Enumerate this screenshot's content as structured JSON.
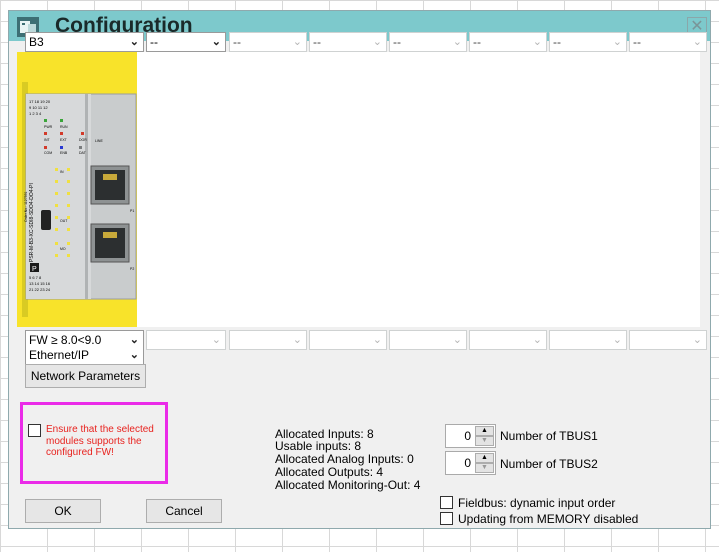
{
  "window": {
    "title": "Configuration",
    "close_glyph": "✕",
    "icon": "module-icon"
  },
  "module_combo": {
    "value": "B3",
    "arrow": "⌄"
  },
  "slot_combos": [
    "--",
    "--",
    "--",
    "--",
    "--",
    "--",
    "--"
  ],
  "fw_combo": {
    "value": "FW ≥ 8.0<9.0",
    "arrow": "⌄"
  },
  "protocol_combo": {
    "value": "Ethernet/IP",
    "arrow": "⌄"
  },
  "network_button": "Network Parameters",
  "module": {
    "label": "PSR-M-B3-XC-SDI8-SDO4-DO4-PI",
    "order_no": "Order.No.: 1127591",
    "top_terminals": [
      "17 18 19 20",
      "9 10 11 12",
      "1 2 3 4"
    ],
    "bottom_terminals": [
      "5 6 7 8",
      "13 14 15 16",
      "21 22 23 24"
    ],
    "leds": [
      "PWR",
      "RUN",
      "INT",
      "EXT",
      "DGR",
      "LINE",
      "COM",
      "ENB",
      "DAT"
    ],
    "io_labels": [
      "IN",
      "OUT",
      "MO"
    ],
    "ports": [
      "P1",
      "P2"
    ],
    "brand": "P"
  },
  "warning": {
    "text": "Ensure that the selected modules supports the configured FW!"
  },
  "allocation": [
    "Allocated Inputs: 8",
    "Usable inputs: 8",
    "Allocated Analog Inputs: 0",
    "Allocated Outputs: 4",
    "Allocated Monitoring-Out: 4"
  ],
  "tbus": [
    {
      "value": "0",
      "label": "Number of TBUS1"
    },
    {
      "value": "0",
      "label": "Number of TBUS2"
    }
  ],
  "options": [
    {
      "label": "Fieldbus: dynamic input order",
      "checked": false
    },
    {
      "label": "Updating from MEMORY disabled",
      "checked": false
    }
  ],
  "buttons": {
    "ok": "OK",
    "cancel": "Cancel"
  },
  "colors": {
    "titlebar": "#7dc9cc",
    "module_yellow": "#f8e32a",
    "warning_text": "#e8231f",
    "highlight": "#ea2be8"
  }
}
